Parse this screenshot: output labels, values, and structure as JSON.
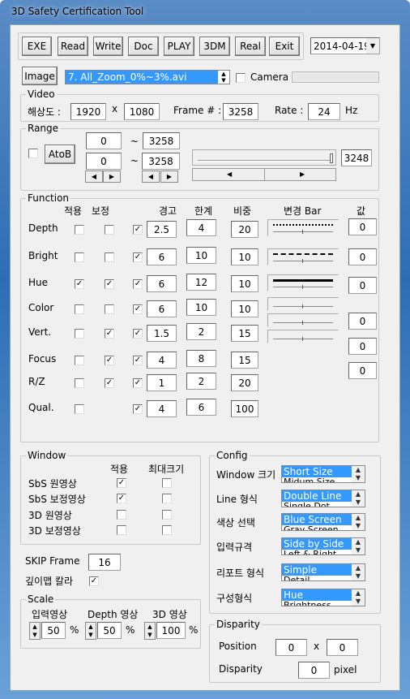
{
  "window": {
    "title": "3D Safety Certification Tool"
  },
  "toolbar": {
    "buttons": [
      "EXE",
      "Read",
      "Write",
      "Doc",
      "PLAY",
      "3DM",
      "Real",
      "Exit"
    ],
    "date": "2014-04-19"
  },
  "image": {
    "button": "Image",
    "file": "7. All_Zoom_0%~3%.avi",
    "camera_label": "Camera",
    "camera_checked": false
  },
  "video": {
    "title": "Video",
    "res_label": "해상도 :",
    "width": "1920",
    "x": "x",
    "height": "1080",
    "frame_label": "Frame # :",
    "frame": "3258",
    "rate_label": "Rate :",
    "rate": "24",
    "hz": "Hz"
  },
  "range": {
    "title": "Range",
    "atob": "AtoB",
    "a_start": "0",
    "a_end": "3258",
    "b_start": "0",
    "b_end": "3258",
    "tilde": "~",
    "slider_value": "3248"
  },
  "function": {
    "title": "Function",
    "headers": {
      "apply": "적용",
      "correct": "보정",
      "warn": "경고",
      "limit": "한계",
      "weight": "비중",
      "bar": "변경 Bar",
      "value": "값"
    },
    "rows": [
      {
        "name": "Depth",
        "apply": false,
        "correct": false,
        "enabled": true,
        "warn": "2.5",
        "limit": "4",
        "weight": "20"
      },
      {
        "name": "Bright",
        "apply": false,
        "correct": false,
        "enabled": true,
        "warn": "6",
        "limit": "10",
        "weight": "10"
      },
      {
        "name": "Hue",
        "apply": true,
        "correct": true,
        "enabled": true,
        "warn": "6",
        "limit": "12",
        "weight": "10"
      },
      {
        "name": "Color",
        "apply": false,
        "correct": false,
        "enabled": true,
        "warn": "6",
        "limit": "10",
        "weight": "10"
      },
      {
        "name": "Vert.",
        "apply": false,
        "correct": true,
        "enabled": true,
        "warn": "1.5",
        "limit": "2",
        "weight": "15"
      },
      {
        "name": "Focus",
        "apply": false,
        "correct": true,
        "enabled": true,
        "warn": "4",
        "limit": "8",
        "weight": "15"
      },
      {
        "name": "R/Z",
        "apply": false,
        "correct": true,
        "enabled": true,
        "warn": "1",
        "limit": "2",
        "weight": "20"
      },
      {
        "name": "Qual.",
        "apply": false,
        "correct": null,
        "enabled": true,
        "warn": "4",
        "limit": "6",
        "weight": "100"
      }
    ],
    "values": [
      "0",
      "0",
      "0",
      "0",
      "0",
      "0"
    ]
  },
  "winopts": {
    "title": "Window",
    "h_apply": "적용",
    "h_max": "최대크기",
    "rows": [
      {
        "label": "SbS 원영상",
        "apply": true,
        "max": false
      },
      {
        "label": "SbS 보정영상",
        "apply": true,
        "max": false
      },
      {
        "label": "3D 원영상",
        "apply": false,
        "max": false
      },
      {
        "label": "3D 보정영상",
        "apply": false,
        "max": false
      }
    ]
  },
  "skip": {
    "label": "SKIP Frame",
    "value": "16"
  },
  "depthmap": {
    "label": "깊이맵 칼라",
    "checked": true
  },
  "scale": {
    "title": "Scale",
    "items": [
      {
        "label": "입력영상",
        "value": "50"
      },
      {
        "label": "Depth 영상",
        "value": "50"
      },
      {
        "label": "3D 영상",
        "value": "100"
      }
    ],
    "unit": "%"
  },
  "config": {
    "title": "Config",
    "rows": [
      {
        "label": "Window 크기",
        "selected": "Short Size",
        "next": "Midum Size"
      },
      {
        "label": "Line 형식",
        "selected": "Double Line",
        "next": "Single Dot"
      },
      {
        "label": "색상 선택",
        "selected": "Blue Screen",
        "next": "Gray Screen"
      },
      {
        "label": "입력규격",
        "selected": "Side by Side",
        "next": "Left & Right"
      },
      {
        "label": "리포트 형식",
        "selected": "Simple",
        "next": "Detail"
      },
      {
        "label": "구성형식",
        "selected": "Hue",
        "next": "Brightness"
      }
    ]
  },
  "disparity": {
    "title": "Disparity",
    "pos_label": "Position",
    "pos_x": "0",
    "x": "x",
    "pos_y": "0",
    "disp_label": "Disparity",
    "disp": "0",
    "unit": "pixel"
  },
  "colors": {
    "selection": "#3399ff",
    "titlebar": "#2e6db4"
  }
}
